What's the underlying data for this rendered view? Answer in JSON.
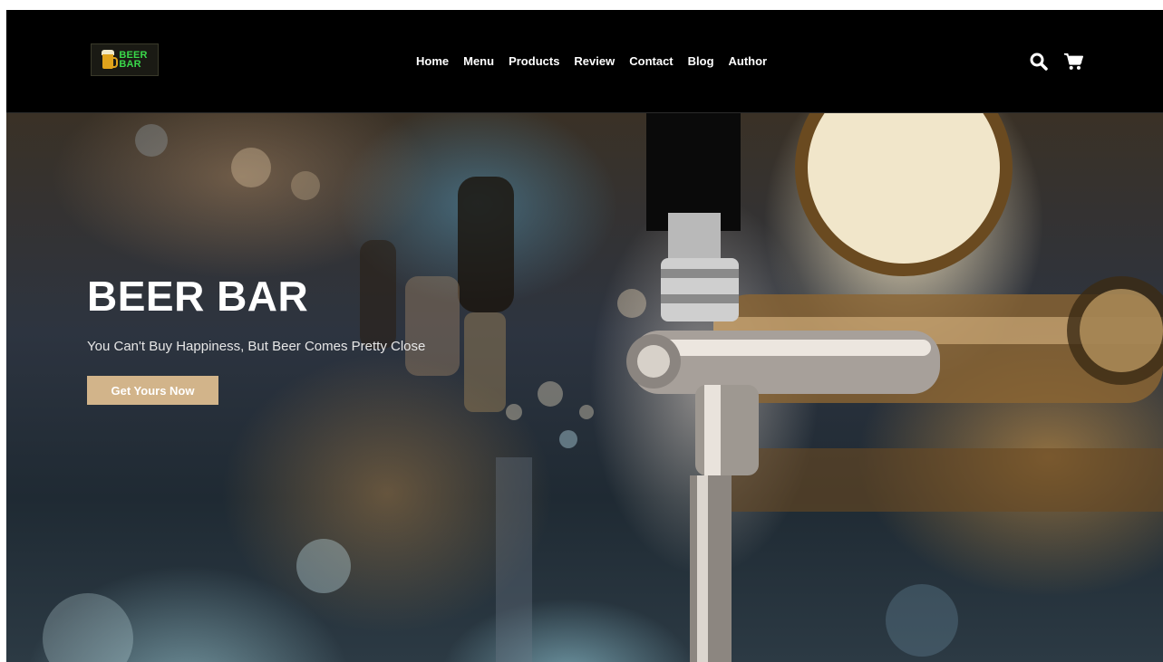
{
  "logo": {
    "line1": "BEER",
    "line2": "BAR"
  },
  "nav": {
    "items": [
      {
        "label": "Home"
      },
      {
        "label": "Menu"
      },
      {
        "label": "Products"
      },
      {
        "label": "Review"
      },
      {
        "label": "Contact"
      },
      {
        "label": "Blog"
      },
      {
        "label": "Author"
      }
    ]
  },
  "icons": {
    "search": "search-icon",
    "cart": "cart-icon"
  },
  "hero": {
    "title": "BEER BAR",
    "subtitle": "You Can't Buy Happiness, But Beer Comes Pretty Close",
    "cta_label": "Get Yours Now"
  },
  "colors": {
    "header_bg": "#000000",
    "cta_bg": "#d2b48a",
    "logo_text": "#39d84a"
  }
}
